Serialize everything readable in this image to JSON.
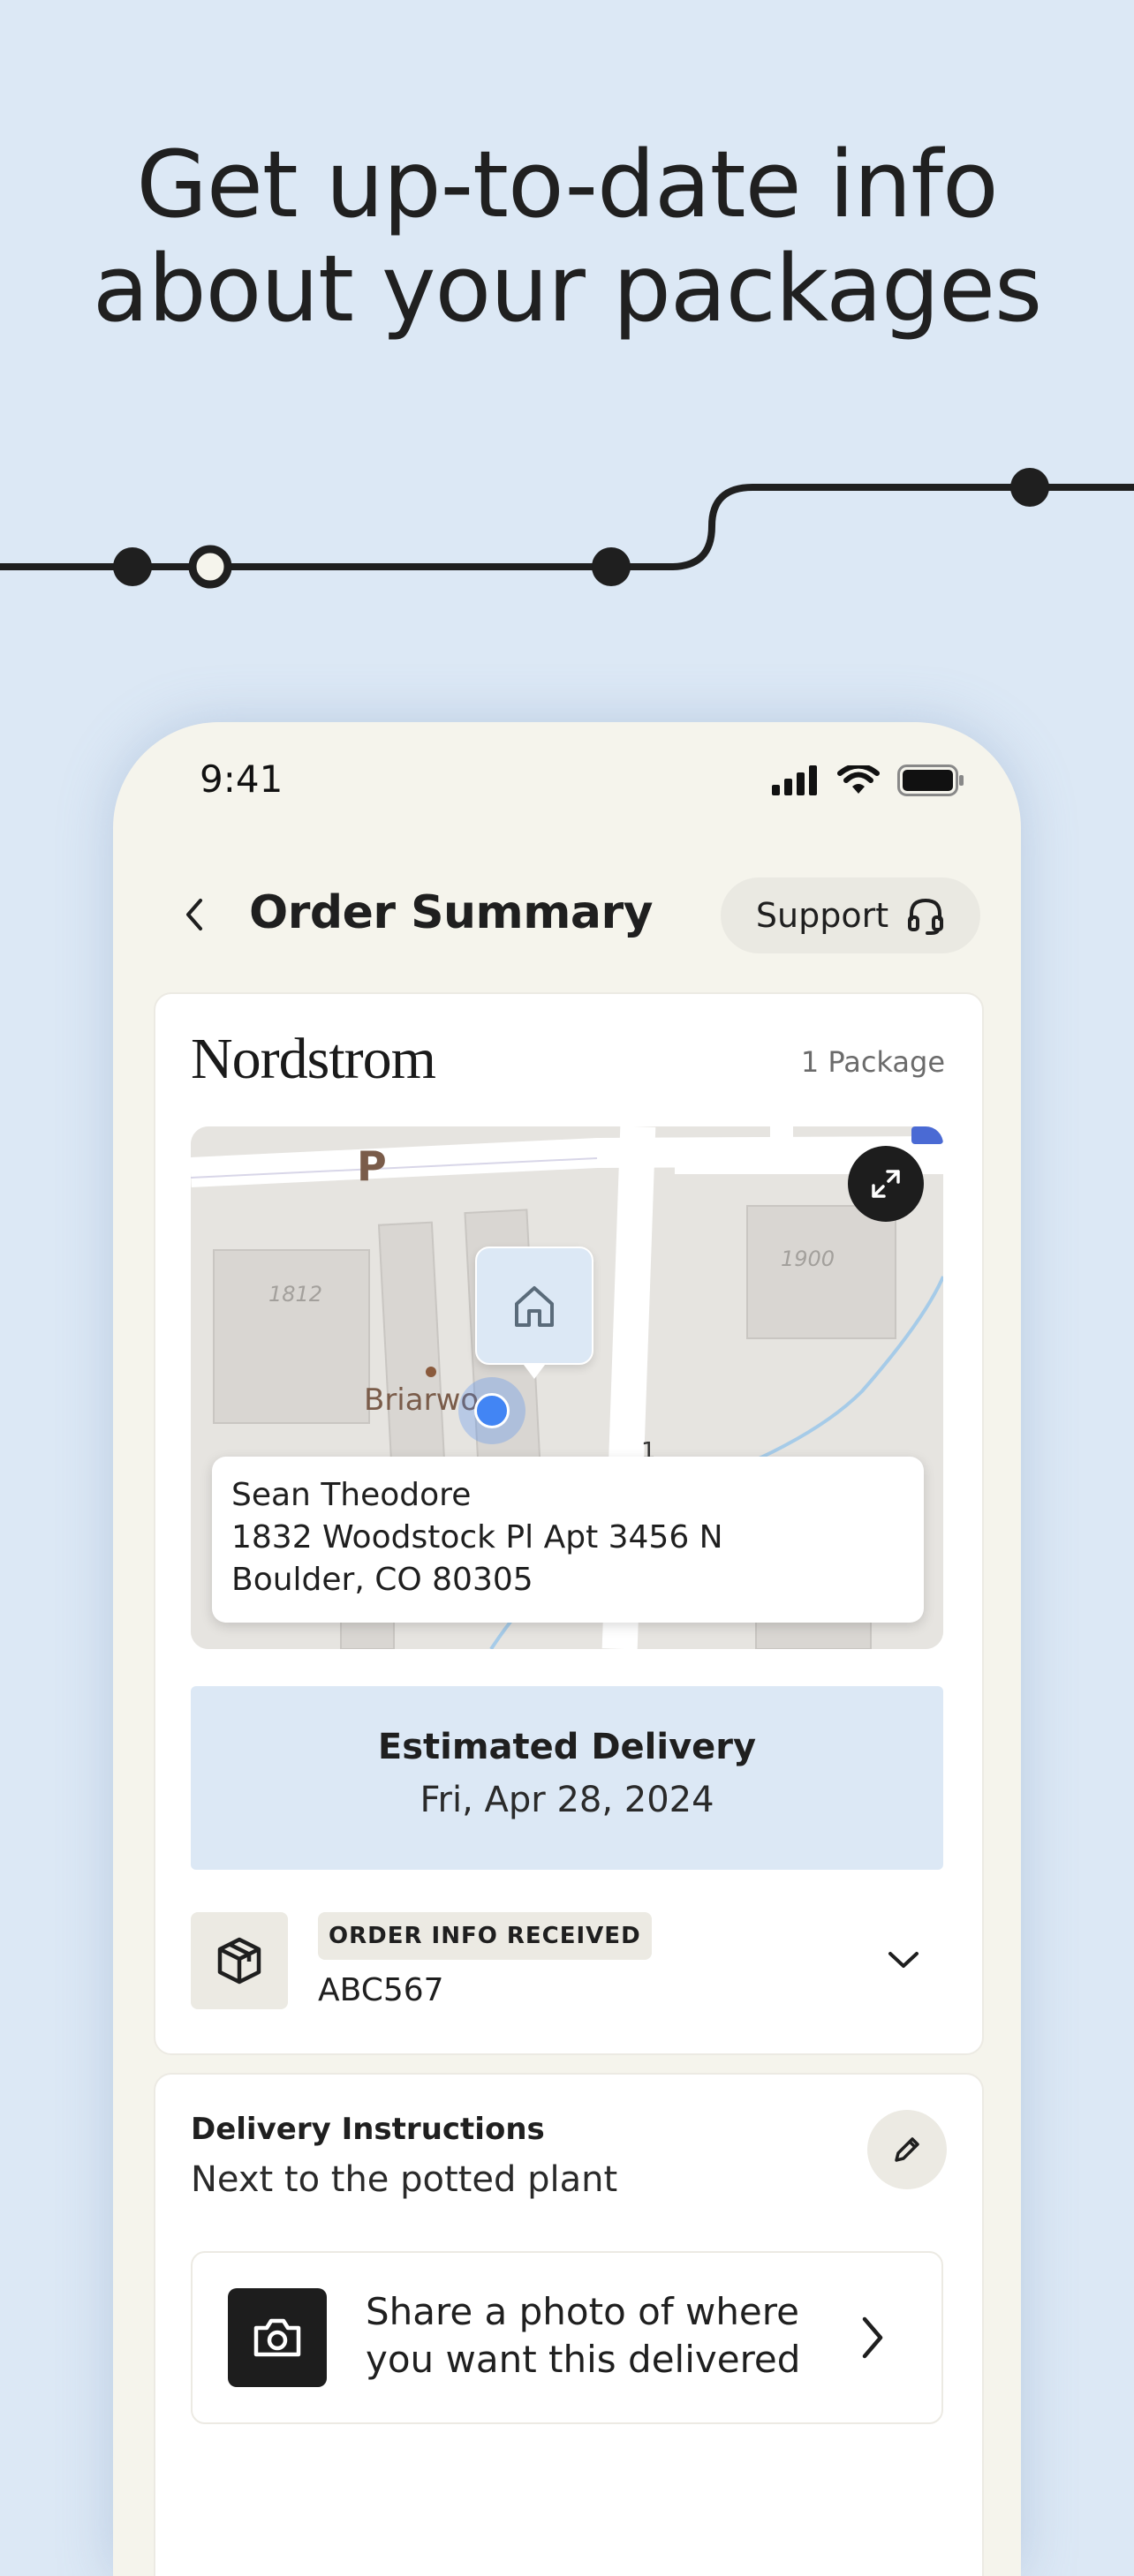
{
  "headline": {
    "line1": "Get up-to-date info",
    "line2": "about your packages"
  },
  "status_bar": {
    "time": "9:41"
  },
  "header": {
    "title": "Order Summary",
    "support_label": "Support"
  },
  "order": {
    "brand": "Nordstrom",
    "package_count": "1 Package",
    "map": {
      "place_label": "Briarwo",
      "parking_label": "P"
    },
    "address": {
      "name": "Sean Theodore",
      "line1": "1832 Woodstock Pl Apt 3456 N",
      "line2": "Boulder, CO 80305"
    },
    "eta": {
      "label": "Estimated Delivery",
      "date": "Fri, Apr 28, 2024"
    },
    "status": {
      "badge": "ORDER INFO RECEIVED",
      "id": "ABC567"
    }
  },
  "delivery_instructions": {
    "title": "Delivery Instructions",
    "text": "Next to the potted plant",
    "photo_cta": "Share a photo of where you want this delivered"
  },
  "colors": {
    "background": "#dce8f5",
    "phone_bg": "#f5f4ec",
    "accent_dark": "#1d1d1d",
    "location_blue": "#4285f4"
  }
}
